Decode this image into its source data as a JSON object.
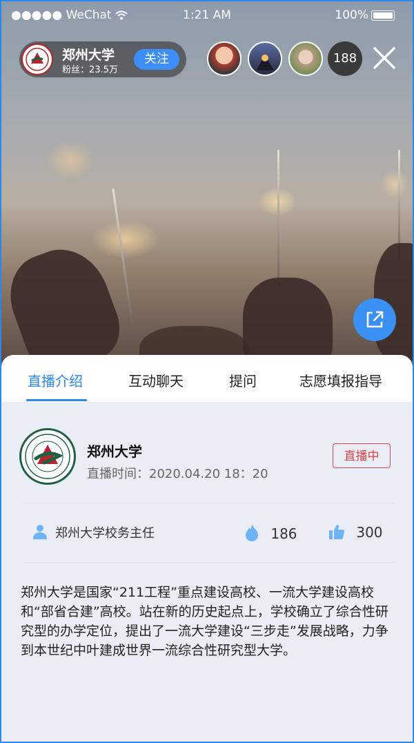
{
  "status_bar": {
    "carrier": "●●●●● WeChat",
    "time": "1:21 AM",
    "battery": "100%"
  },
  "host": {
    "name": "郑州大学",
    "fans": "粉丝：23.5万",
    "follow_label": "关注"
  },
  "viewers": {
    "count": "188"
  },
  "tabs": [
    "直播介绍",
    "互动聊天",
    "提问",
    "志愿填报指导"
  ],
  "info": {
    "university": "郑州大学",
    "live_time": "直播时间：2020.04.20  18：20",
    "live_badge": "直播中",
    "presenter": "郑州大学校务主任",
    "views": "186",
    "likes": "300",
    "description": "郑州大学是国家“211工程”重点建设高校、一流大学建设高校和“部省合建”高校。站在新的历史起点上，学校确立了综合性研究型的办学定位，提出了一流大学建设“三步走”发展战略，力争到本世纪中叶建成世界一流综合性研究型大学。"
  },
  "colors": {
    "accent": "#2b86f0",
    "live_red": "#e0424a"
  }
}
